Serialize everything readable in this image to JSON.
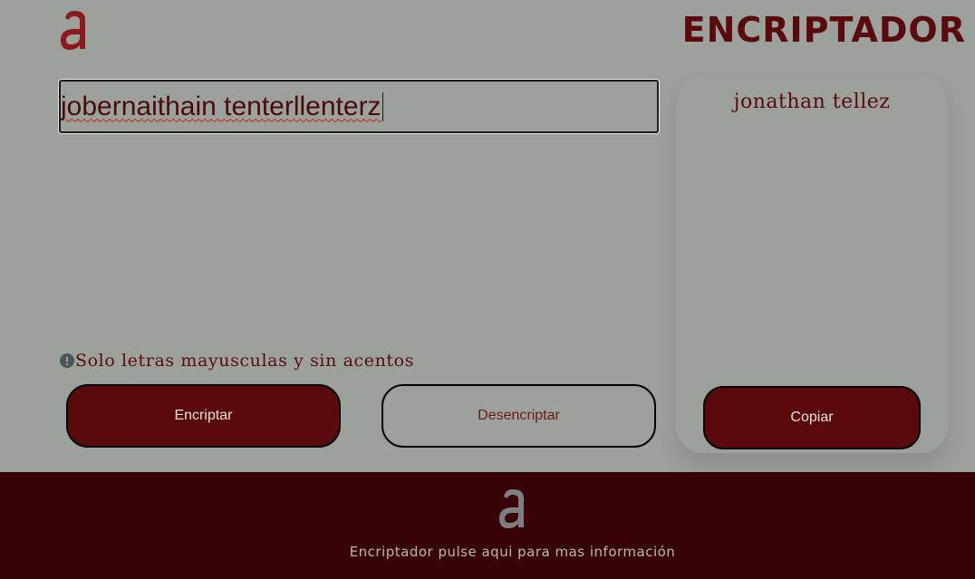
{
  "header": {
    "logo_icon": "alura-a-logo-icon",
    "title": "ENCRIPTADOR"
  },
  "input": {
    "value": "jobernaithain tenterllenterz"
  },
  "warning": {
    "icon": "exclamation-circle-icon",
    "text": "Solo letras mayusculas y sin acentos"
  },
  "buttons": {
    "encrypt_label": "Encriptar",
    "decrypt_label": "Desencriptar",
    "copy_label": "Copiar"
  },
  "output": {
    "text": "jonathan tellez"
  },
  "footer": {
    "logo_icon": "alura-a-logo-icon",
    "link_text": "Encriptador pulse aqui para mas información"
  },
  "colors": {
    "background": "#9ca29b",
    "accent": "#5a0a0d",
    "footer_bg": "#380306",
    "logo_top": "#8a1a1e",
    "logo_footer": "#7d7f82"
  }
}
